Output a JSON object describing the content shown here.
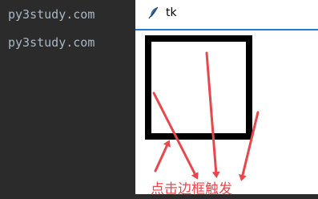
{
  "editor": {
    "lines": [
      "py3study.com",
      "py3study.com"
    ]
  },
  "window": {
    "title": "tk",
    "icon": "feather-icon"
  },
  "annotation": {
    "caption": "点击边框触发",
    "color": "#e8474b"
  },
  "colors": {
    "editor_bg": "#2b2b2b",
    "editor_text": "#a9b7c6",
    "border_accent": "#1f7fd6"
  }
}
